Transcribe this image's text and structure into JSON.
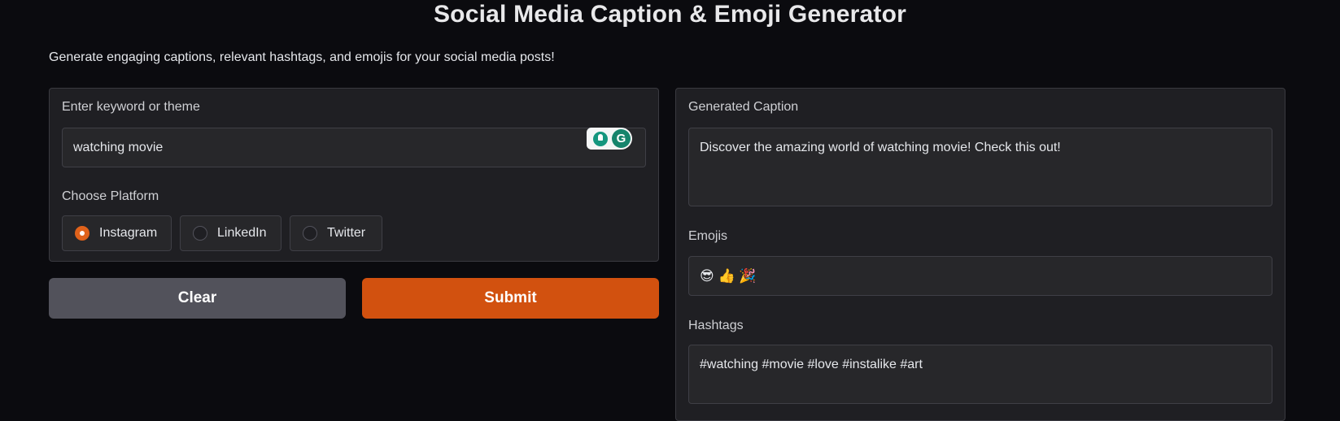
{
  "header": {
    "title": "Social Media Caption & Emoji Generator",
    "description": "Generate engaging captions, relevant hashtags, and emojis for your social media posts!"
  },
  "input_panel": {
    "keyword_label": "Enter keyword or theme",
    "keyword_value": "watching movie",
    "platform_label": "Choose Platform",
    "platforms": [
      {
        "label": "Instagram",
        "selected": true
      },
      {
        "label": "LinkedIn",
        "selected": false
      },
      {
        "label": "Twitter",
        "selected": false
      }
    ]
  },
  "buttons": {
    "clear": "Clear",
    "submit": "Submit"
  },
  "output_panel": {
    "caption_label": "Generated Caption",
    "caption_value": "Discover the amazing world of watching movie! Check this out!",
    "emojis_label": "Emojis",
    "emojis_value": "😎 👍 🎉",
    "hashtags_label": "Hashtags",
    "hashtags_value": "#watching #movie #love #instalike #art"
  },
  "extension": {
    "grammarly_glyph": "G"
  },
  "colors": {
    "background": "#0b0b0f",
    "panel": "#1f1f23",
    "accent": "#d2510f",
    "secondary_button": "#52525b"
  }
}
